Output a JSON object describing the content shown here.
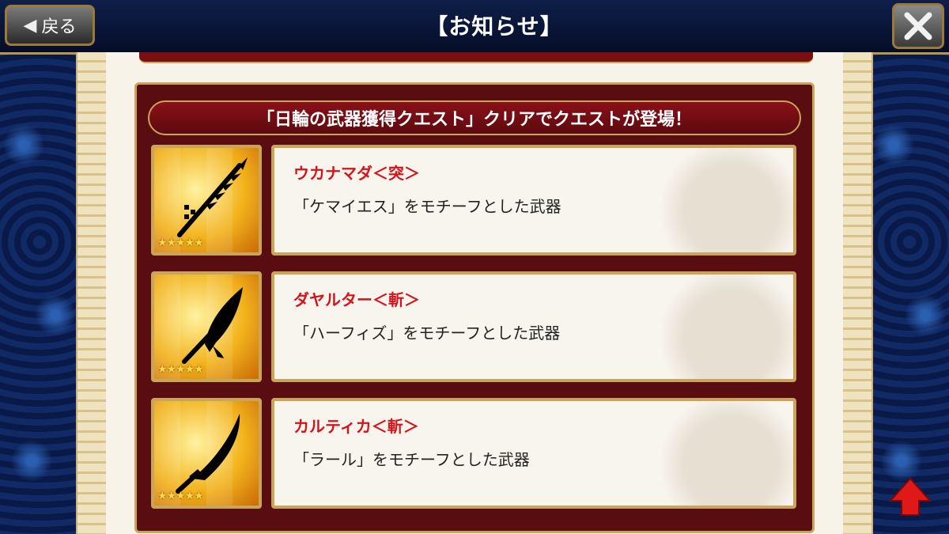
{
  "header": {
    "back_label": "戻る",
    "title": "【お知らせ】"
  },
  "notice": {
    "heading": "「日輪の武器獲得クエスト」クリアでクエストが登場！",
    "weapons": [
      {
        "name": "ウカナマダ＜突＞",
        "description": "「ケマイエス」をモチーフとした武器",
        "stars": "★★★★★",
        "icon": "spear-icon"
      },
      {
        "name": "ダヤルター＜斬＞",
        "description": "「ハーフィズ」をモチーフとした武器",
        "stars": "★★★★★",
        "icon": "broad-sword-icon"
      },
      {
        "name": "カルティカ＜斬＞",
        "description": "「ラール」をモチーフとした武器",
        "stars": "★★★★★",
        "icon": "curved-blade-icon"
      }
    ]
  },
  "colors": {
    "accent_gold": "#c9a55a",
    "frame_red": "#5a0d10",
    "name_red": "#d4141a"
  }
}
